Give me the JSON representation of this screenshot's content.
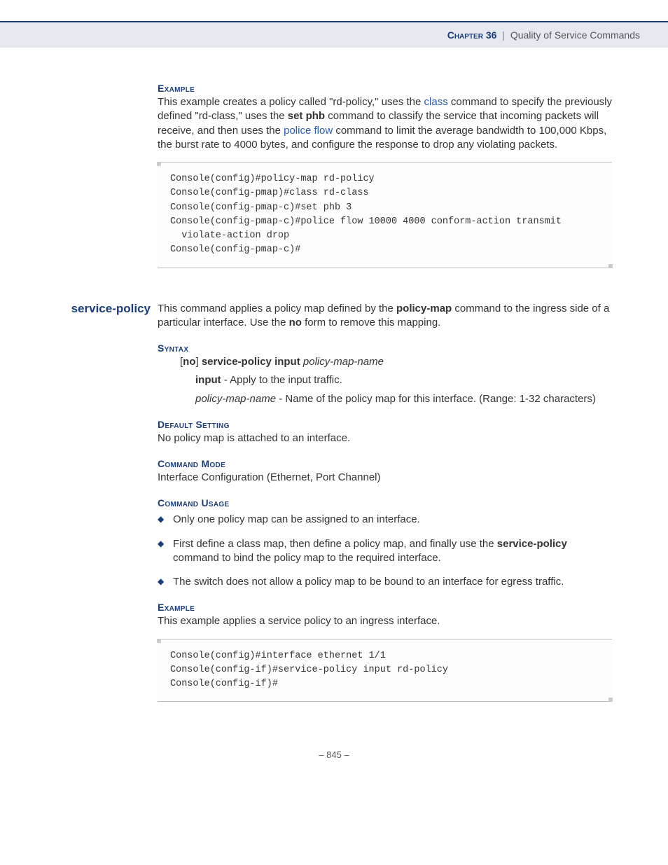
{
  "header": {
    "chapter": "Chapter 36",
    "separator": "|",
    "title": "Quality of Service Commands"
  },
  "sec1": {
    "heading_example": "Example",
    "para1_a": "This example creates a policy called \"rd-policy,\" uses the ",
    "para1_link1": "class",
    "para1_b": " command to specify the previously defined \"rd-class,\" uses the ",
    "para1_bold1": "set phb",
    "para1_c": " command to classify the service that incoming packets will receive, and then uses the ",
    "para1_link2": "police flow",
    "para1_d": " command to limit the average bandwidth to 100,000 Kbps, the burst rate to 4000 bytes, and configure the response to drop any violating packets.",
    "code": "Console(config)#policy-map rd-policy\nConsole(config-pmap)#class rd-class\nConsole(config-pmap-c)#set phb 3\nConsole(config-pmap-c)#police flow 10000 4000 conform-action transmit \n  violate-action drop\nConsole(config-pmap-c)#"
  },
  "sec2": {
    "margin_label": "service-policy",
    "intro_a": "This command applies a policy map defined by the ",
    "intro_bold": "policy-map",
    "intro_b": " command to the ingress side of a particular interface. Use the ",
    "intro_bold2": "no",
    "intro_c": " form to remove this mapping.",
    "heading_syntax": "Syntax",
    "syntax_line_a": "[",
    "syntax_line_no": "no",
    "syntax_line_b": "] ",
    "syntax_line_cmd": "service-policy input",
    "syntax_line_c": " ",
    "syntax_line_arg": "policy-map-name",
    "syntax_input_b": "input",
    "syntax_input_t": " - Apply to the input traffic.",
    "syntax_pmn_i": "policy-map-name",
    "syntax_pmn_t": " - Name of the policy map for this interface. (Range: 1-32 characters)",
    "heading_default": "Default Setting",
    "default_text": "No policy map is attached to an interface.",
    "heading_mode": "Command Mode",
    "mode_text": "Interface Configuration (Ethernet, Port Channel)",
    "heading_usage": "Command Usage",
    "usage1": "Only one policy map can be assigned to an interface.",
    "usage2_a": "First define a class map, then define a policy map, and finally use the ",
    "usage2_b": "service-policy",
    "usage2_c": " command to bind the policy map to the required interface.",
    "usage3": "The switch does not allow a policy map to be bound to an interface for egress traffic.",
    "heading_example": "Example",
    "example_text": "This example applies a service policy to an ingress interface.",
    "code": "Console(config)#interface ethernet 1/1\nConsole(config-if)#service-policy input rd-policy\nConsole(config-if)#"
  },
  "pagenum": "– 845 –"
}
